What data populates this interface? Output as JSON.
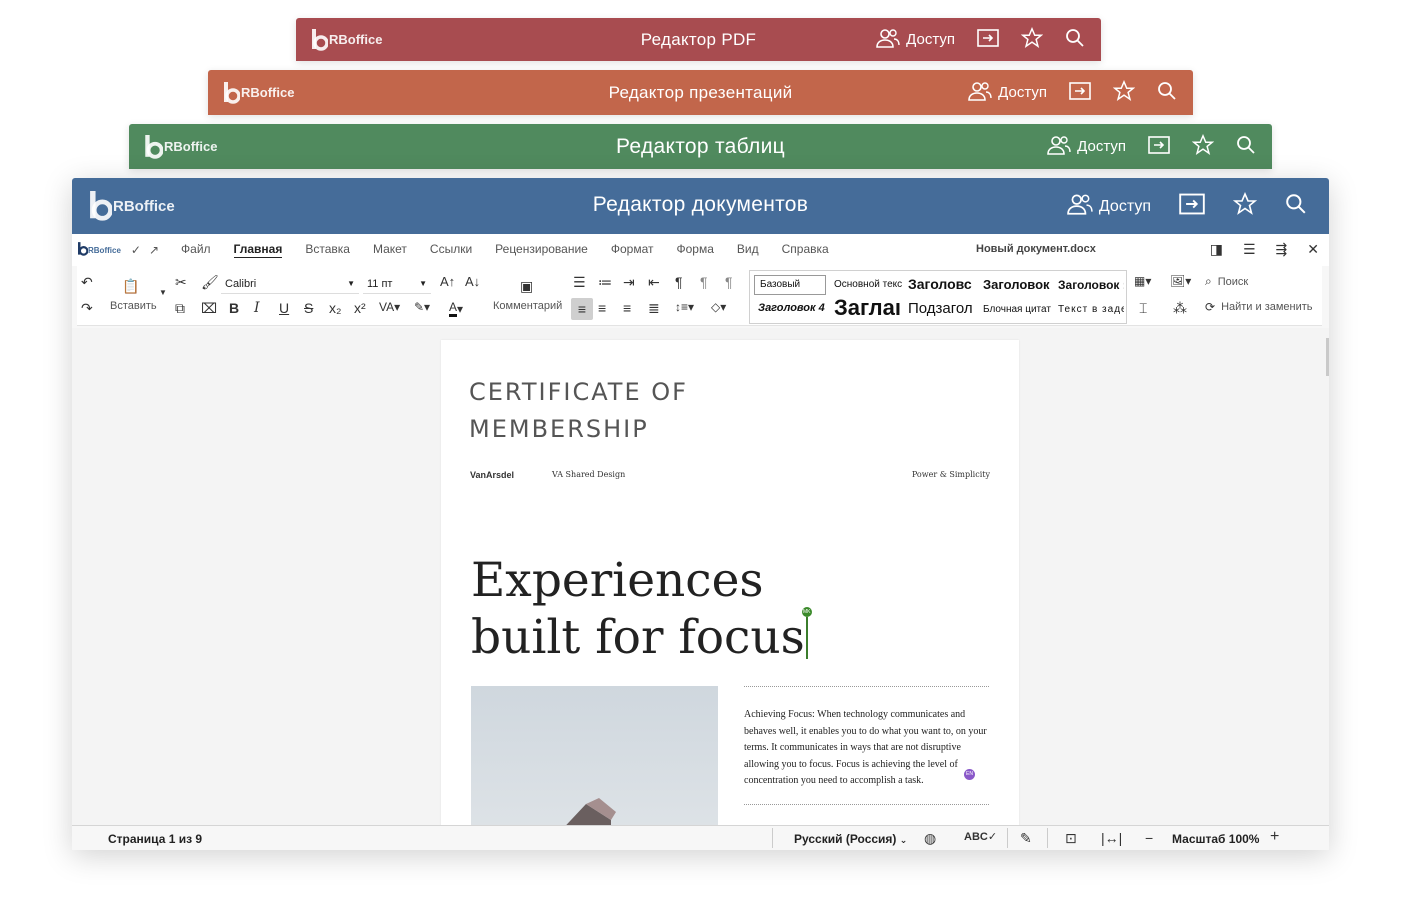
{
  "logo": {
    "text": "RBoffice"
  },
  "windows": {
    "pdf": {
      "title": "Редактор PDF",
      "access_label": "Доступ"
    },
    "presentation": {
      "title": "Редактор презентаций",
      "access_label": "Доступ"
    },
    "spreadsheet": {
      "title": "Редактор таблиц",
      "access_label": "Доступ"
    },
    "document": {
      "title": "Редактор документов",
      "access_label": "Доступ"
    }
  },
  "colors": {
    "pdf_header": "#a84c50",
    "presentation_header": "#c2664b",
    "spreadsheet_header": "#508a5e",
    "document_header": "#456c99"
  },
  "menubar": {
    "mini_logo": "RBoffice",
    "tabs": [
      "Файл",
      "Главная",
      "Вставка",
      "Макет",
      "Ссылки",
      "Рецензирование",
      "Формат",
      "Форма",
      "Вид",
      "Справка"
    ],
    "active_tab": "Главная",
    "document_name": "Новый документ.docx"
  },
  "ribbon": {
    "paste_label": "Вставить",
    "font_name": "Calibri",
    "font_size": "11 пт",
    "comment_label": "Комментарий",
    "styles": [
      "Базовый",
      "Основной текс",
      "Заголовс",
      "Заголовок",
      "Заголовок :",
      "Заголовок 4",
      "Заглаı",
      "Подзагол",
      "Блочная цитат",
      "Текст в заде"
    ],
    "search_label": "Поиск",
    "replace_label": "Найти и заменить"
  },
  "page": {
    "certificate_line1": "CERTIFICATE OF",
    "certificate_line2": "MEMBERSHIP",
    "brand_logo": "VanArsdel",
    "brand_sub": "VA Shared Design",
    "brand_right": "Power & Simplicity",
    "headline_line1": "Experiences",
    "headline_line2": "built for focus",
    "cursor_user_initials": "MK",
    "body_text": "Achieving Focus: When technology communicates and behaves well, it enables you to do what you want to, on your terms. It communicates in ways that are not disruptive allowing you to focus. Focus is achieving the level of concentration you need to accomplish a task.",
    "language_marker": "EN"
  },
  "statusbar": {
    "page_count": "Страница 1 из 9",
    "language": "Русский (Россия)",
    "zoom": "Масштаб 100%"
  }
}
